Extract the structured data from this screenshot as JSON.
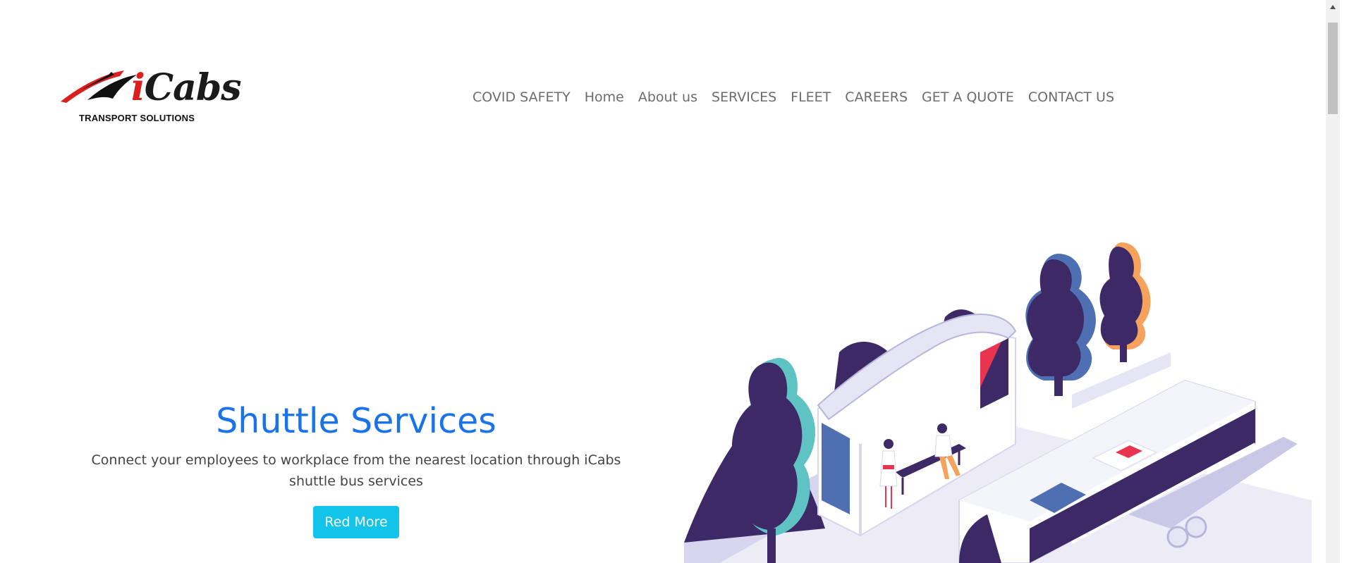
{
  "brand": {
    "logo_word_i": "i",
    "logo_word_rest": "Cabs",
    "tagline": "TRANSPORT SOLUTIONS",
    "colors": {
      "red": "#d9201f",
      "black": "#1a1a1a"
    }
  },
  "nav": {
    "items": [
      {
        "label": "COVID SAFETY"
      },
      {
        "label": "Home"
      },
      {
        "label": "About us"
      },
      {
        "label": "SERVICES"
      },
      {
        "label": "FLEET"
      },
      {
        "label": "CAREERS"
      },
      {
        "label": "GET A QUOTE"
      },
      {
        "label": "CONTACT US"
      }
    ]
  },
  "hero": {
    "title": "Shuttle Services",
    "description": "Connect your employees to workplace from the nearest location through iCabs shuttle bus services",
    "button_label": "Red More",
    "illustration": "isometric-bus-stop-illustration",
    "colors": {
      "title": "#1a73e8",
      "button": "#12c3ea",
      "tree": "#3d2966"
    }
  }
}
